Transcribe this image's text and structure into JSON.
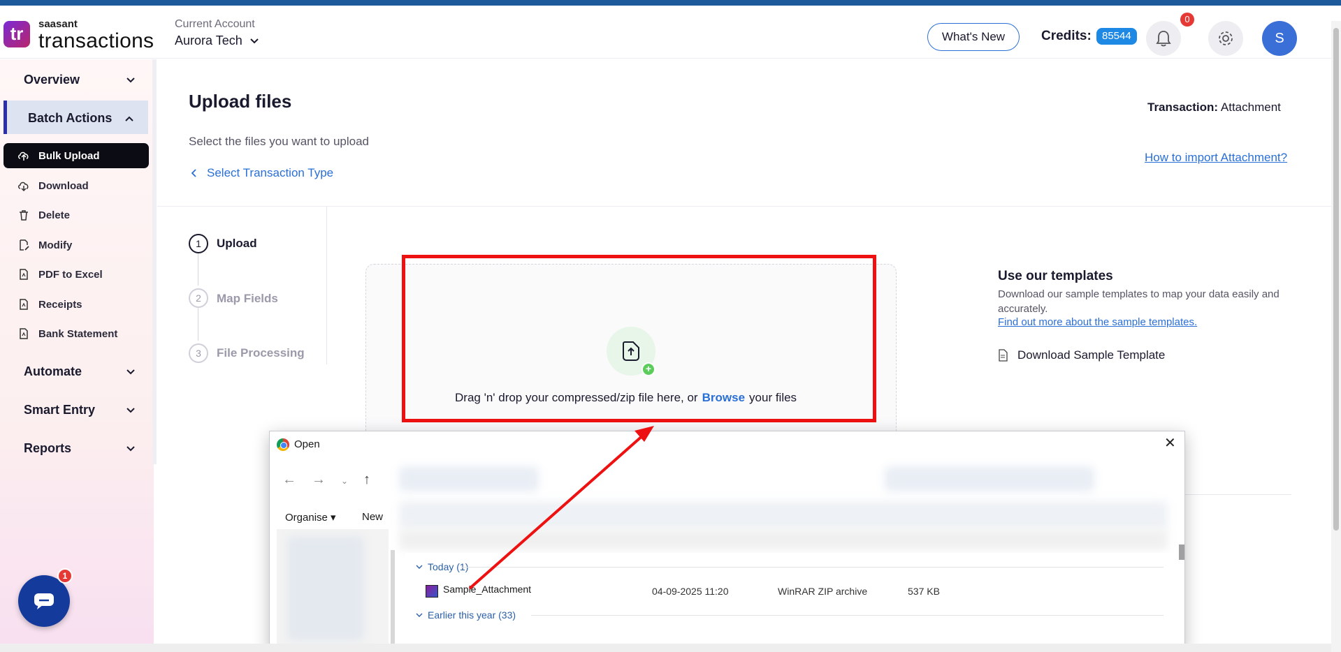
{
  "header": {
    "logo_mark": "tr",
    "brand_top": "saasant",
    "brand_main": "transactions",
    "account_label": "Current Account",
    "account_name": "Aurora Tech",
    "whats_new": "What's New",
    "credits_label": "Credits:",
    "credits_value": "85544",
    "notification_count": "0",
    "avatar_initial": "S"
  },
  "sidebar": {
    "groups": {
      "overview": "Overview",
      "batch_actions": "Batch Actions",
      "automate": "Automate",
      "smart_entry": "Smart Entry",
      "reports": "Reports"
    },
    "batch_items": [
      {
        "label": "Bulk Upload",
        "icon": "upload-cloud-icon",
        "active": true
      },
      {
        "label": "Download",
        "icon": "download-cloud-icon"
      },
      {
        "label": "Delete",
        "icon": "trash-icon"
      },
      {
        "label": "Modify",
        "icon": "edit-file-icon"
      },
      {
        "label": "PDF to Excel",
        "icon": "pdf-file-icon"
      },
      {
        "label": "Receipts",
        "icon": "receipt-file-icon"
      },
      {
        "label": "Bank Statement",
        "icon": "statement-file-icon"
      }
    ],
    "chat_badge": "1"
  },
  "main": {
    "title": "Upload files",
    "subtitle": "Select the files you want to upload",
    "back_link": "Select Transaction Type",
    "transaction_label": "Transaction:",
    "transaction_value": "Attachment",
    "how_link": "How to import Attachment?",
    "steps": [
      {
        "num": "1",
        "label": "Upload",
        "active": true
      },
      {
        "num": "2",
        "label": "Map Fields",
        "active": false
      },
      {
        "num": "3",
        "label": "File Processing",
        "active": false
      }
    ],
    "dropzone": {
      "text_before": "Drag 'n' drop your compressed/zip file here, or",
      "browse": "Browse",
      "text_after": "your files"
    },
    "templates": {
      "title": "Use our templates",
      "description": "Download our sample templates to map your data easily and accurately.",
      "link": "Find out more about the sample templates.",
      "download": "Download Sample Template"
    }
  },
  "dialog": {
    "title": "Open",
    "organise": "Organise",
    "new": "New",
    "groups": [
      "Today (1)",
      "Earlier this year (33)"
    ],
    "file": {
      "name": "Sample_Attachment",
      "date": "04-09-2025 11:20",
      "type": "WinRAR ZIP archive",
      "size": "537 KB"
    }
  }
}
